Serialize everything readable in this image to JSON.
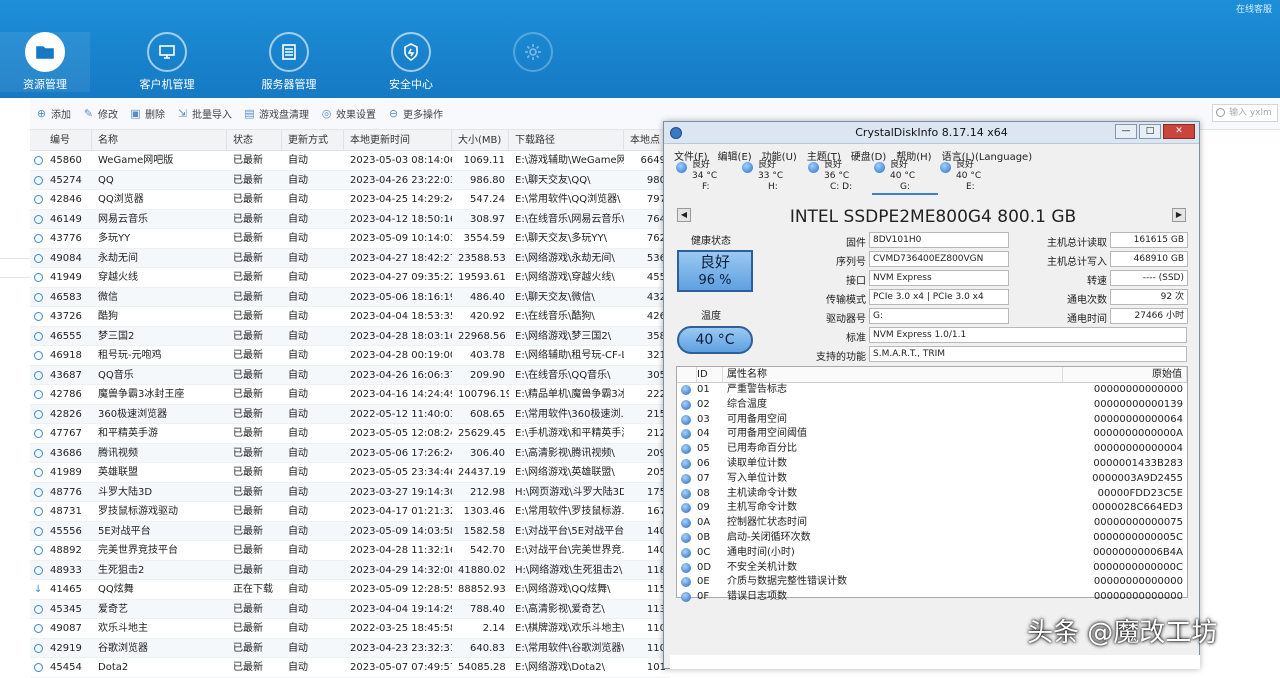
{
  "corner_text": "在线客服",
  "nav": [
    {
      "label": "资源管理",
      "icon": "folder-icon"
    },
    {
      "label": "客户机管理",
      "icon": "monitor-icon"
    },
    {
      "label": "服务器管理",
      "icon": "server-icon"
    },
    {
      "label": "安全中心",
      "icon": "shield-icon"
    },
    {
      "label": "",
      "icon": "gear-icon"
    }
  ],
  "toolbar": [
    "添加",
    "修改",
    "删除",
    "批量导入",
    "游戏盘清理",
    "效果设置",
    "更多操作"
  ],
  "search_placeholder": "输入 yxlm",
  "table": {
    "headers": [
      "编号",
      "名称",
      "状态",
      "更新方式",
      "本地更新时间",
      "大小(MB)",
      "下载路径",
      "本地点"
    ],
    "rows": [
      [
        "45860",
        "WeGame网吧版",
        "已最新",
        "自动",
        "2023-05-03 08:14:06",
        "1069.11",
        "E:\\游戏辅助\\WeGame网...",
        "6649"
      ],
      [
        "45274",
        "QQ",
        "已最新",
        "自动",
        "2023-04-26 23:22:03",
        "986.80",
        "E:\\聊天交友\\QQ\\",
        "980"
      ],
      [
        "42846",
        "QQ浏览器",
        "已最新",
        "自动",
        "2023-04-25 14:29:24",
        "547.24",
        "E:\\常用软件\\QQ浏览器\\",
        "797"
      ],
      [
        "46149",
        "网易云音乐",
        "已最新",
        "自动",
        "2023-04-12 18:50:16",
        "308.97",
        "E:\\在线音乐\\网易云音乐\\",
        "764"
      ],
      [
        "43776",
        "多玩YY",
        "已最新",
        "自动",
        "2023-05-09 10:14:03",
        "3554.59",
        "E:\\聊天交友\\多玩YY\\",
        "762"
      ],
      [
        "49084",
        "永劫无间",
        "已最新",
        "自动",
        "2023-04-27 18:42:27",
        "23588.53",
        "E:\\网络游戏\\永劫无间\\",
        "536"
      ],
      [
        "41949",
        "穿越火线",
        "已最新",
        "自动",
        "2023-04-27 09:35:22",
        "19593.61",
        "E:\\网络游戏\\穿越火线\\",
        "455"
      ],
      [
        "46583",
        "微信",
        "已最新",
        "自动",
        "2023-05-06 18:16:19",
        "486.40",
        "E:\\聊天交友\\微信\\",
        "432"
      ],
      [
        "43726",
        "酷狗",
        "已最新",
        "自动",
        "2023-04-04 18:53:35",
        "420.92",
        "E:\\在线音乐\\酷狗\\",
        "426"
      ],
      [
        "46555",
        "梦三国2",
        "已最新",
        "自动",
        "2023-04-28 18:03:16",
        "22968.56",
        "E:\\网络游戏\\梦三国2\\",
        "358"
      ],
      [
        "46918",
        "租号玩-元咆鸡",
        "已最新",
        "自动",
        "2023-04-28 00:19:00",
        "403.78",
        "E:\\网络辅助\\租号玩-CF-L...",
        "321"
      ],
      [
        "43687",
        "QQ音乐",
        "已最新",
        "自动",
        "2023-04-26 16:06:37",
        "209.90",
        "E:\\在线音乐\\QQ音乐\\",
        "305"
      ],
      [
        "42786",
        "魔兽争霸3冰封王座",
        "已最新",
        "自动",
        "2023-04-16 14:24:49",
        "100796.19",
        "E:\\精品单机\\魔兽争霸3冰...",
        "222"
      ],
      [
        "42826",
        "360极速浏览器",
        "已最新",
        "自动",
        "2022-05-12 11:40:03",
        "608.65",
        "E:\\常用软件\\360极速浏...",
        "215"
      ],
      [
        "47767",
        "和平精英手游",
        "已最新",
        "自动",
        "2023-05-05 12:08:24",
        "25629.45",
        "E:\\手机游戏\\和平精英手游\\",
        "212"
      ],
      [
        "43686",
        "腾讯视频",
        "已最新",
        "自动",
        "2023-05-06 17:26:24",
        "306.40",
        "E:\\高清影视\\腾讯视频\\",
        "209"
      ],
      [
        "41989",
        "英雄联盟",
        "已最新",
        "自动",
        "2023-05-05 23:34:46",
        "24437.19",
        "E:\\网络游戏\\英雄联盟\\",
        "205"
      ],
      [
        "48776",
        "斗罗大陆3D",
        "已最新",
        "自动",
        "2023-03-27 19:14:30",
        "212.98",
        "H:\\网页游戏\\斗罗大陆3D\\",
        "175"
      ],
      [
        "48731",
        "罗技鼠标游戏驱动",
        "已最新",
        "自动",
        "2023-04-17 01:21:32",
        "1303.46",
        "E:\\常用软件\\罗技鼠标游...",
        "167"
      ],
      [
        "45556",
        "5E对战平台",
        "已最新",
        "自动",
        "2023-05-09 14:03:58",
        "1582.58",
        "E:\\对战平台\\5E对战平台\\",
        "140"
      ],
      [
        "48892",
        "完美世界竞技平台",
        "已最新",
        "自动",
        "2023-04-28 11:32:16",
        "542.70",
        "E:\\对战平台\\完美世界竞...",
        "140"
      ],
      [
        "48933",
        "生死狙击2",
        "已最新",
        "自动",
        "2023-04-29 14:32:08",
        "41880.02",
        "H:\\网络游戏\\生死狙击2\\",
        "118"
      ],
      [
        "41465",
        "QQ炫舞",
        "正在下载",
        "自动",
        "2023-05-09 12:28:55",
        "88852.93",
        "E:\\网络游戏\\QQ炫舞\\",
        "115"
      ],
      [
        "45345",
        "爱奇艺",
        "已最新",
        "自动",
        "2023-04-04 19:14:29",
        "788.40",
        "E:\\高清影视\\爱奇艺\\",
        "113"
      ],
      [
        "49087",
        "欢乐斗地主",
        "已最新",
        "自动",
        "2022-03-25 18:45:58",
        "2.14",
        "E:\\棋牌游戏\\欢乐斗地主\\",
        "110"
      ],
      [
        "42919",
        "谷歌浏览器",
        "已最新",
        "自动",
        "2023-04-23 23:32:31",
        "640.83",
        "E:\\常用软件\\谷歌浏览器\\",
        "110"
      ],
      [
        "45454",
        "Dota2",
        "已最新",
        "自动",
        "2023-05-07 07:49:57",
        "54085.28",
        "E:\\网络游戏\\Dota2\\",
        "101"
      ]
    ]
  },
  "cdi": {
    "title": "CrystalDiskInfo 8.17.14 x64",
    "menu": [
      "文件(F)",
      "编辑(E)",
      "功能(U)",
      "主题(T)",
      "硬盘(D)",
      "帮助(H)",
      "语言(L)(Language)"
    ],
    "drives": [
      {
        "status": "良好",
        "temp": "34 °C",
        "letter": "F:"
      },
      {
        "status": "良好",
        "temp": "33 °C",
        "letter": "H:"
      },
      {
        "status": "良好",
        "temp": "36 °C",
        "letter": "C: D:"
      },
      {
        "status": "良好",
        "temp": "40 °C",
        "letter": "G:"
      },
      {
        "status": "良好",
        "temp": "40 °C",
        "letter": "E:"
      }
    ],
    "model": "INTEL SSDPE2ME800G4 800.1 GB",
    "health_label": "健康状态",
    "health_status": "良好",
    "health_pct": "96 %",
    "temp_label": "温度",
    "temp_value": "40 °C",
    "fields": {
      "firmware_label": "固件",
      "firmware": "8DV101H0",
      "serial_label": "序列号",
      "serial": "CVMD736400EZ800VGN",
      "interface_label": "接口",
      "interface": "NVM Express",
      "transfer_label": "传输模式",
      "transfer": "PCIe 3.0 x4 | PCIe 3.0 x4",
      "drive_label": "驱动器号",
      "drive": "G:",
      "standard_label": "标准",
      "standard": "NVM Express 1.0/1.1",
      "features_label": "支持的功能",
      "features": "S.M.A.R.T., TRIM",
      "reads_label": "主机总计读取",
      "reads": "161615 GB",
      "writes_label": "主机总计写入",
      "writes": "468910 GB",
      "rpm_label": "转速",
      "rpm": "---- (SSD)",
      "power_count_label": "通电次数",
      "power_count": "92 次",
      "power_hours_label": "通电时间",
      "power_hours": "27466 小时"
    },
    "attr_headers": [
      "ID",
      "属性名称",
      "原始值"
    ],
    "attrs": [
      [
        "01",
        "严重警告标志",
        "00000000000000"
      ],
      [
        "02",
        "综合温度",
        "00000000000139"
      ],
      [
        "03",
        "可用备用空间",
        "00000000000064"
      ],
      [
        "04",
        "可用备用空间阈值",
        "0000000000000A"
      ],
      [
        "05",
        "已用寿命百分比",
        "00000000000004"
      ],
      [
        "06",
        "读取单位计数",
        "0000001433B283"
      ],
      [
        "07",
        "写入单位计数",
        "0000003A9D2455"
      ],
      [
        "08",
        "主机读命令计数",
        "00000FDD23C5E"
      ],
      [
        "09",
        "主机写命令计数",
        "0000028C664ED3"
      ],
      [
        "0A",
        "控制器忙状态时间",
        "00000000000075"
      ],
      [
        "0B",
        "启动-关闭循环次数",
        "0000000000005C"
      ],
      [
        "0C",
        "通电时间(小时)",
        "00000000006B4A"
      ],
      [
        "0D",
        "不安全关机计数",
        "0000000000000C"
      ],
      [
        "0E",
        "介质与数据完整性错误计数",
        "00000000000000"
      ],
      [
        "0F",
        "错误日志项数",
        "00000000000000"
      ]
    ]
  },
  "watermark": "头条 @魔改工坊"
}
